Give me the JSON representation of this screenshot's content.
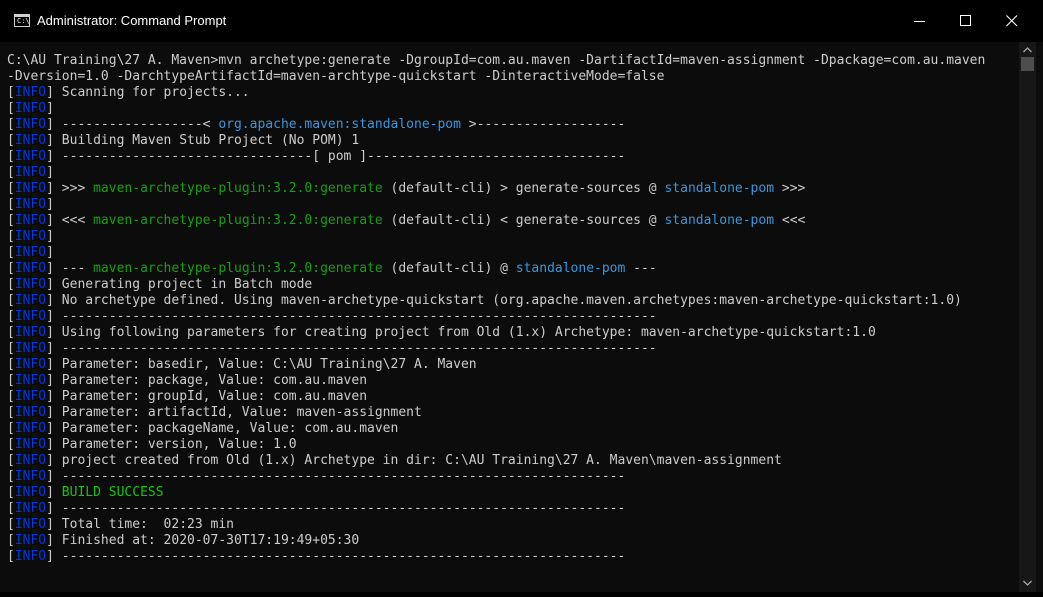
{
  "window": {
    "title": "Administrator: Command Prompt",
    "icon_text": "C:\\",
    "icons": {
      "app": "command-prompt-icon",
      "minimize": "minimize-icon",
      "maximize": "maximize-icon",
      "close": "close-icon",
      "scroll_up": "chevron-up-icon",
      "scroll_down": "chevron-down-icon"
    }
  },
  "colors": {
    "background": "#0c0c0c",
    "text": "#cccccc",
    "info_tag": "#0037da",
    "plugin": "#13a10e",
    "project": "#3a96dd",
    "success": "#16c60c"
  },
  "console": {
    "lines": [
      [
        {
          "t": "C:\\AU Training\\27 A. Maven>mvn archetype:generate -DgroupId=com.au.maven -DartifactId=maven-assignment -Dpackage=com.au.maven"
        }
      ],
      [
        {
          "t": "-Dversion=1.0 -DarchtypeArtifactId=maven-archtype-quickstart -DinteractiveMode=false"
        }
      ],
      [
        {
          "t": "["
        },
        {
          "t": "INFO",
          "c": "i"
        },
        {
          "t": "] Scanning for projects..."
        }
      ],
      [
        {
          "t": "["
        },
        {
          "t": "INFO",
          "c": "i"
        },
        {
          "t": "]"
        }
      ],
      [
        {
          "t": "["
        },
        {
          "t": "INFO",
          "c": "i"
        },
        {
          "t": "] ------------------< "
        },
        {
          "t": "org.apache.maven:standalone-pom",
          "c": "c"
        },
        {
          "t": " >-------------------"
        }
      ],
      [
        {
          "t": "["
        },
        {
          "t": "INFO",
          "c": "i"
        },
        {
          "t": "] Building Maven Stub Project (No POM) 1"
        }
      ],
      [
        {
          "t": "["
        },
        {
          "t": "INFO",
          "c": "i"
        },
        {
          "t": "] --------------------------------[ pom ]---------------------------------"
        }
      ],
      [
        {
          "t": "["
        },
        {
          "t": "INFO",
          "c": "i"
        },
        {
          "t": "]"
        }
      ],
      [
        {
          "t": "["
        },
        {
          "t": "INFO",
          "c": "i"
        },
        {
          "t": "] >>> "
        },
        {
          "t": "maven-archetype-plugin:3.2.0:generate",
          "c": "g"
        },
        {
          "t": " (default-cli) > generate-sources @ "
        },
        {
          "t": "standalone-pom",
          "c": "c"
        },
        {
          "t": " >>>"
        }
      ],
      [
        {
          "t": "["
        },
        {
          "t": "INFO",
          "c": "i"
        },
        {
          "t": "]"
        }
      ],
      [
        {
          "t": "["
        },
        {
          "t": "INFO",
          "c": "i"
        },
        {
          "t": "] <<< "
        },
        {
          "t": "maven-archetype-plugin:3.2.0:generate",
          "c": "g"
        },
        {
          "t": " (default-cli) < generate-sources @ "
        },
        {
          "t": "standalone-pom",
          "c": "c"
        },
        {
          "t": " <<<"
        }
      ],
      [
        {
          "t": "["
        },
        {
          "t": "INFO",
          "c": "i"
        },
        {
          "t": "]"
        }
      ],
      [
        {
          "t": "["
        },
        {
          "t": "INFO",
          "c": "i"
        },
        {
          "t": "]"
        }
      ],
      [
        {
          "t": "["
        },
        {
          "t": "INFO",
          "c": "i"
        },
        {
          "t": "] --- "
        },
        {
          "t": "maven-archetype-plugin:3.2.0:generate",
          "c": "g"
        },
        {
          "t": " (default-cli) @ "
        },
        {
          "t": "standalone-pom",
          "c": "c"
        },
        {
          "t": " ---"
        }
      ],
      [
        {
          "t": "["
        },
        {
          "t": "INFO",
          "c": "i"
        },
        {
          "t": "] Generating project in Batch mode"
        }
      ],
      [
        {
          "t": "["
        },
        {
          "t": "INFO",
          "c": "i"
        },
        {
          "t": "] No archetype defined. Using maven-archetype-quickstart (org.apache.maven.archetypes:maven-archetype-quickstart:1.0)"
        }
      ],
      [
        {
          "t": "["
        },
        {
          "t": "INFO",
          "c": "i"
        },
        {
          "t": "] ----------------------------------------------------------------------------"
        }
      ],
      [
        {
          "t": "["
        },
        {
          "t": "INFO",
          "c": "i"
        },
        {
          "t": "] Using following parameters for creating project from Old (1.x) Archetype: maven-archetype-quickstart:1.0"
        }
      ],
      [
        {
          "t": "["
        },
        {
          "t": "INFO",
          "c": "i"
        },
        {
          "t": "] ----------------------------------------------------------------------------"
        }
      ],
      [
        {
          "t": "["
        },
        {
          "t": "INFO",
          "c": "i"
        },
        {
          "t": "] Parameter: basedir, Value: C:\\AU Training\\27 A. Maven"
        }
      ],
      [
        {
          "t": "["
        },
        {
          "t": "INFO",
          "c": "i"
        },
        {
          "t": "] Parameter: package, Value: com.au.maven"
        }
      ],
      [
        {
          "t": "["
        },
        {
          "t": "INFO",
          "c": "i"
        },
        {
          "t": "] Parameter: groupId, Value: com.au.maven"
        }
      ],
      [
        {
          "t": "["
        },
        {
          "t": "INFO",
          "c": "i"
        },
        {
          "t": "] Parameter: artifactId, Value: maven-assignment"
        }
      ],
      [
        {
          "t": "["
        },
        {
          "t": "INFO",
          "c": "i"
        },
        {
          "t": "] Parameter: packageName, Value: com.au.maven"
        }
      ],
      [
        {
          "t": "["
        },
        {
          "t": "INFO",
          "c": "i"
        },
        {
          "t": "] Parameter: version, Value: 1.0"
        }
      ],
      [
        {
          "t": "["
        },
        {
          "t": "INFO",
          "c": "i"
        },
        {
          "t": "] project created from Old (1.x) Archetype in dir: C:\\AU Training\\27 A. Maven\\maven-assignment"
        }
      ],
      [
        {
          "t": "["
        },
        {
          "t": "INFO",
          "c": "i"
        },
        {
          "t": "] ------------------------------------------------------------------------"
        }
      ],
      [
        {
          "t": "["
        },
        {
          "t": "INFO",
          "c": "i"
        },
        {
          "t": "] "
        },
        {
          "t": "BUILD SUCCESS",
          "c": "b"
        }
      ],
      [
        {
          "t": "["
        },
        {
          "t": "INFO",
          "c": "i"
        },
        {
          "t": "] ------------------------------------------------------------------------"
        }
      ],
      [
        {
          "t": "["
        },
        {
          "t": "INFO",
          "c": "i"
        },
        {
          "t": "] Total time:  02:23 min"
        }
      ],
      [
        {
          "t": "["
        },
        {
          "t": "INFO",
          "c": "i"
        },
        {
          "t": "] Finished at: 2020-07-30T17:19:49+05:30"
        }
      ],
      [
        {
          "t": "["
        },
        {
          "t": "INFO",
          "c": "i"
        },
        {
          "t": "] ------------------------------------------------------------------------"
        }
      ]
    ]
  }
}
